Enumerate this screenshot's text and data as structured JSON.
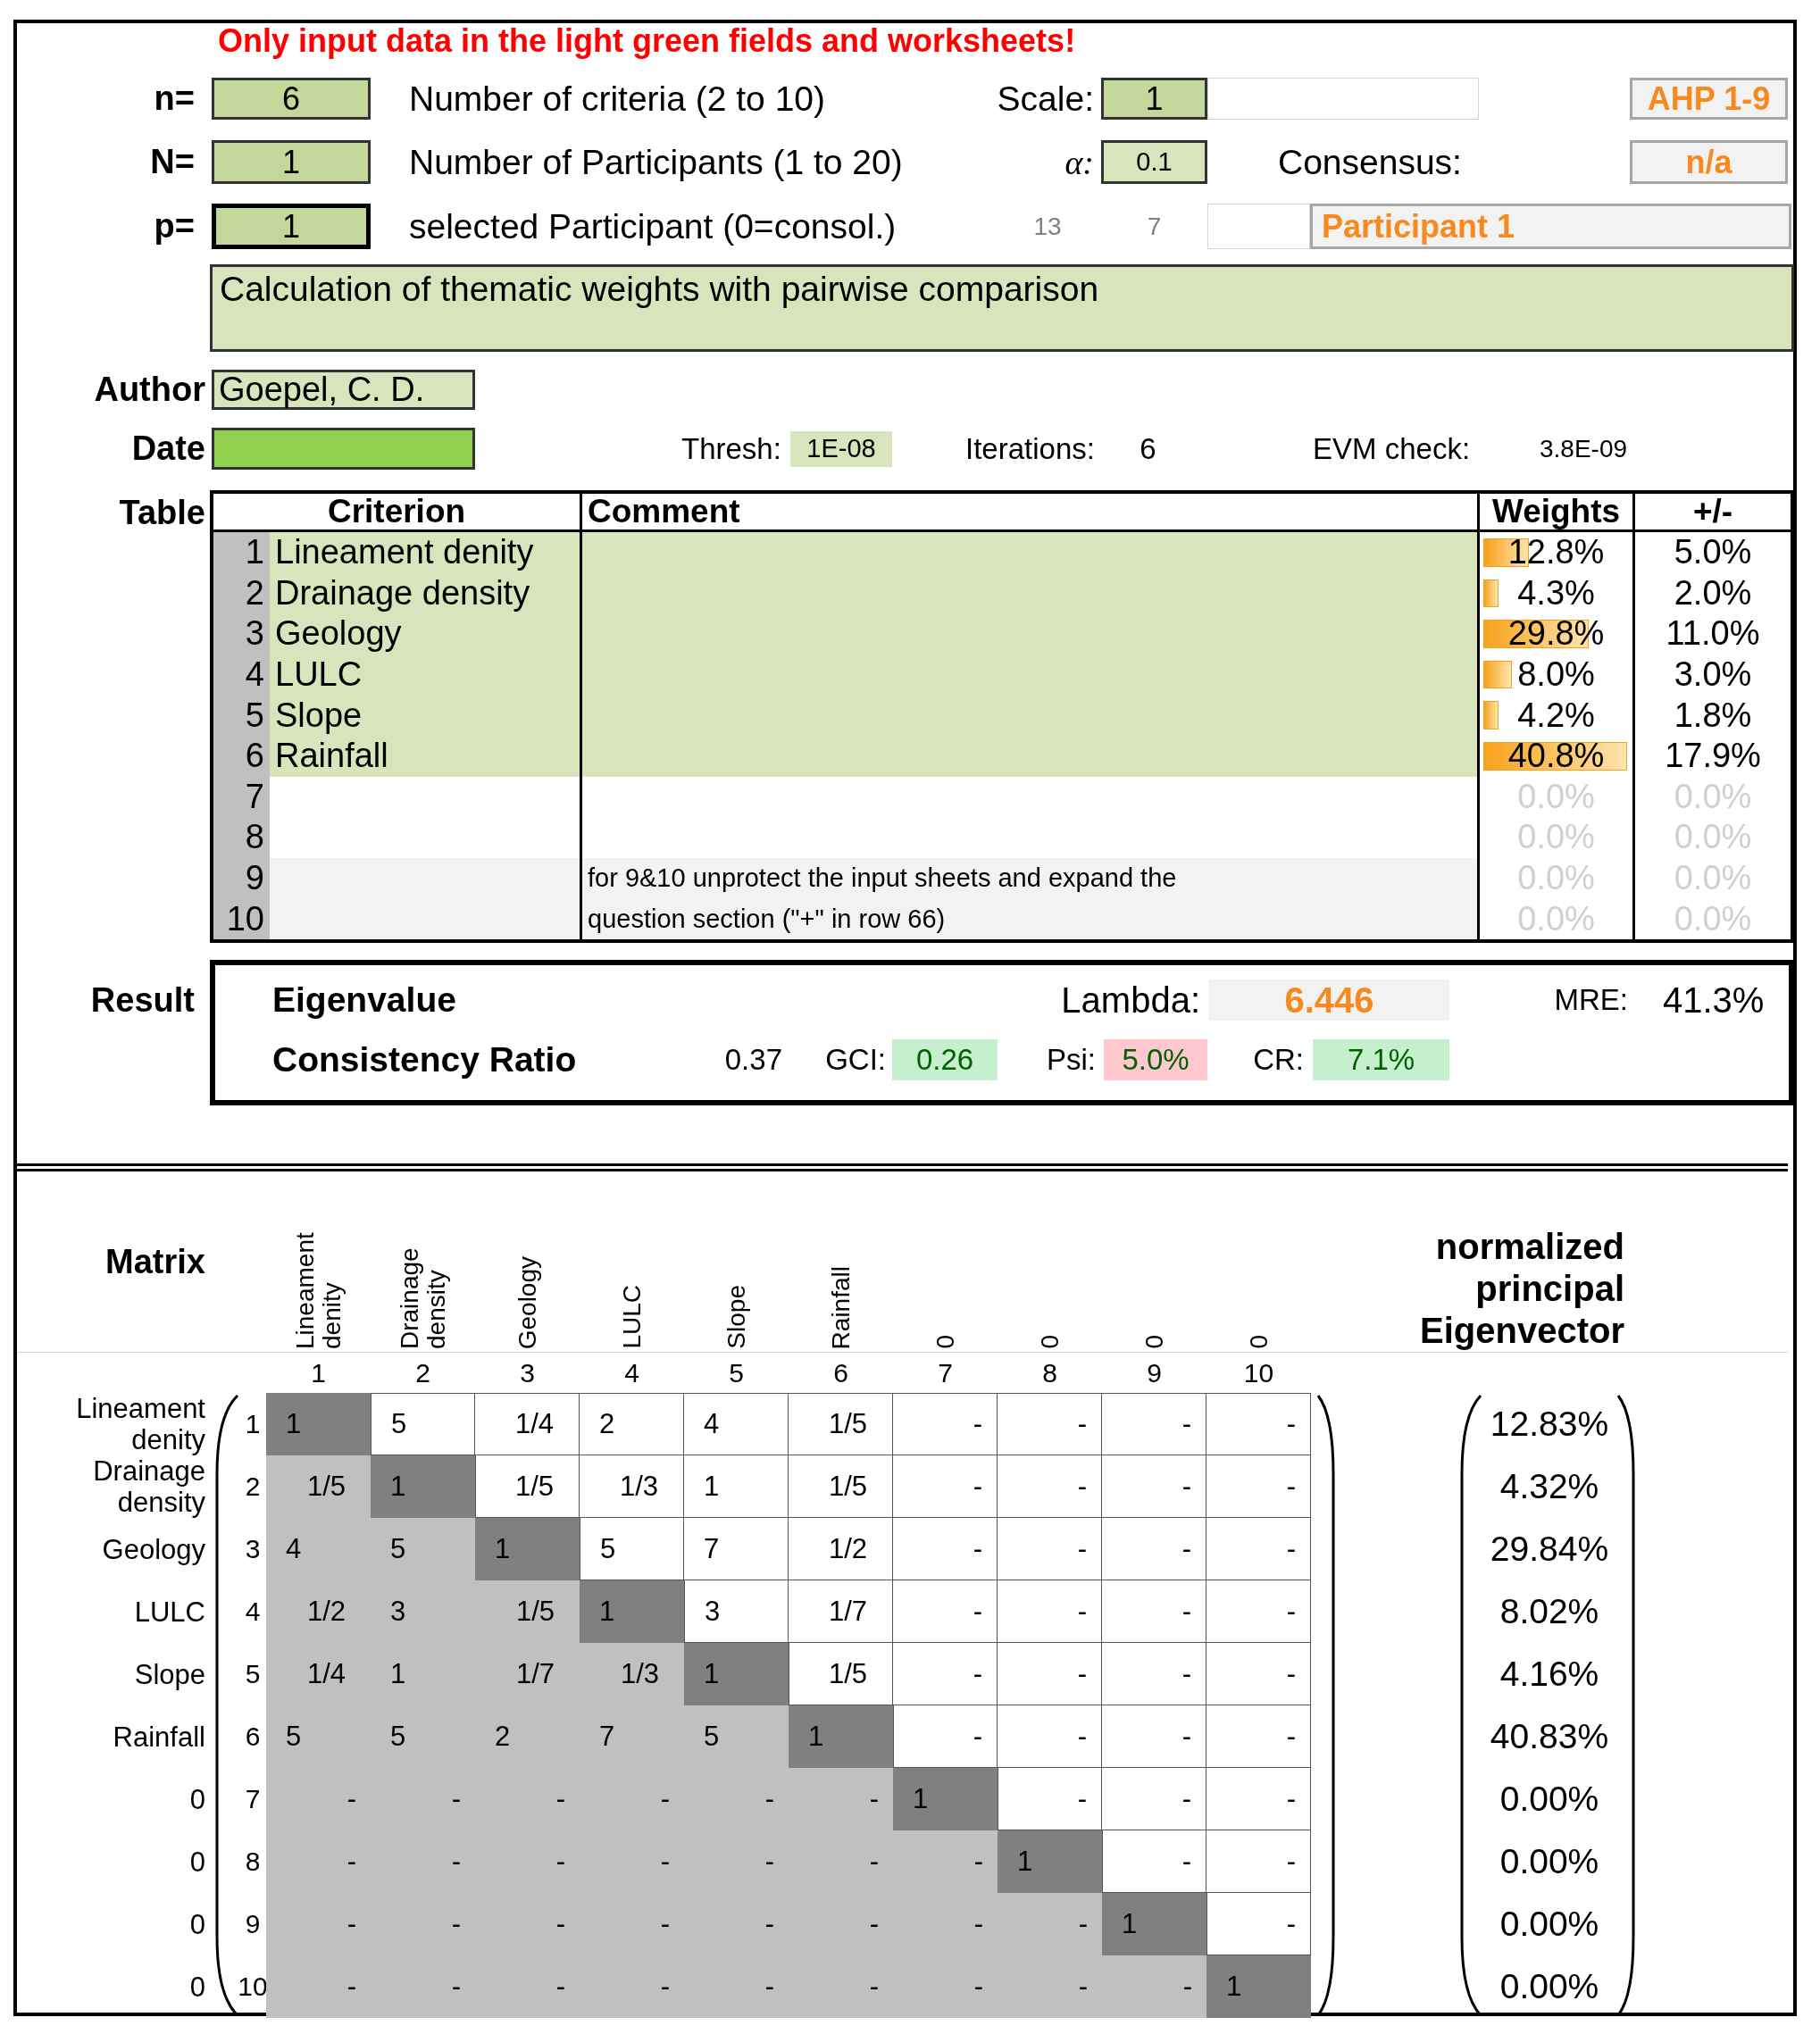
{
  "notice": "Only input data in the light green fields and worksheets!",
  "criteria_count": {
    "label": "n=",
    "value": "6",
    "description": "Number of criteria (2 to 10)",
    "focused": false
  },
  "scale": {
    "label": "Scale:",
    "value": "1",
    "name": "AHP 1-9"
  },
  "participants": {
    "label": "N=",
    "value": "1",
    "description": "Number of Participants (1 to 20)",
    "focused": false
  },
  "alpha": {
    "label": "α:",
    "value": "0.1"
  },
  "consensus": {
    "label": "Consensus:",
    "value": "n/a"
  },
  "participant": {
    "label": "p=",
    "value": "1",
    "description": "selected Participant (0=consol.)",
    "focused": true,
    "numbers": [
      "13",
      "7"
    ],
    "name": "Participant 1"
  },
  "project_title": "Calculation of thematic weights with pairwise comparison",
  "author": {
    "label": "Author",
    "value": "Goepel, C. D."
  },
  "date": {
    "label": "Date"
  },
  "solver": {
    "thresh_label": "Thresh:",
    "thresh": "1E-08",
    "iterations_label": "Iterations:",
    "iterations": "6",
    "evm_label": "EVM check:",
    "evm": "3.8E-09"
  },
  "table": {
    "label": "Table",
    "columns": [
      "Criterion",
      "Comment",
      "Weights",
      "+/-"
    ],
    "rows": [
      {
        "number": "1",
        "criterion": "Lineament denity",
        "weight": "12.8%",
        "level": 0.314,
        "error": "5.0%",
        "kind": "input",
        "disabled": false
      },
      {
        "number": "2",
        "criterion": "Drainage density",
        "weight": "4.3%",
        "level": 0.105,
        "error": "2.0%",
        "kind": "input",
        "disabled": false
      },
      {
        "number": "3",
        "criterion": "Geology",
        "weight": "29.8%",
        "level": 0.73,
        "error": "11.0%",
        "kind": "input",
        "disabled": false
      },
      {
        "number": "4",
        "criterion": "LULC",
        "weight": "8.0%",
        "level": 0.196,
        "error": "3.0%",
        "kind": "input",
        "disabled": false
      },
      {
        "number": "5",
        "criterion": "Slope",
        "weight": "4.2%",
        "level": 0.103,
        "error": "1.8%",
        "kind": "input",
        "disabled": false
      },
      {
        "number": "6",
        "criterion": "Rainfall",
        "weight": "40.8%",
        "level": 1,
        "error": "17.9%",
        "kind": "input",
        "disabled": false
      },
      {
        "number": "7",
        "weight": "0.0%",
        "error": "0.0%",
        "kind": "blank",
        "disabled": true
      },
      {
        "number": "8",
        "weight": "0.0%",
        "error": "0.0%",
        "kind": "blank",
        "disabled": true
      },
      {
        "number": "9",
        "comment": "for 9&10 unprotect the input sheets and expand the",
        "weight": "0.0%",
        "error": "0.0%",
        "kind": "note",
        "disabled": true
      },
      {
        "number": "10",
        "comment": "question section (\"+\" in row 66)",
        "weight": "0.0%",
        "error": "0.0%",
        "kind": "note",
        "disabled": true
      }
    ]
  },
  "result": {
    "label": "Result",
    "eigenvalue": {
      "name": "Eigenvalue",
      "label": "Lambda:",
      "value": "6.446",
      "mre_label": "MRE:",
      "mre": "41.3%"
    },
    "consistency": {
      "name": "Consistency Ratio",
      "value": "0.37",
      "metrics": [
        {
          "label": "GCI:",
          "value": "0.26",
          "kind": "pass"
        },
        {
          "label": "Psi:",
          "value": "5.0%",
          "kind": "fail"
        },
        {
          "label": "CR:",
          "value": "7.1%",
          "kind": "pass"
        }
      ]
    }
  },
  "matrix": {
    "label": "Matrix",
    "eigenvector_title": "normalized principal Eigenvector",
    "columns": [
      {
        "header": "Lineament denity",
        "number": "1"
      },
      {
        "header": "Drainage density",
        "number": "2"
      },
      {
        "header": "Geology",
        "number": "3"
      },
      {
        "header": "LULC",
        "number": "4"
      },
      {
        "header": "Slope",
        "number": "5"
      },
      {
        "header": "Rainfall",
        "number": "6"
      },
      {
        "header": "0",
        "number": "7"
      },
      {
        "header": "0",
        "number": "8"
      },
      {
        "header": "0",
        "number": "9"
      },
      {
        "header": "0",
        "number": "10"
      }
    ],
    "rows": [
      {
        "label": "Lineament denity",
        "number": "1",
        "cells": [
          "1",
          "5",
          "1/4",
          "2",
          "4",
          "1/5",
          "-",
          "-",
          "-",
          "-"
        ],
        "eigenvector": "12.83%"
      },
      {
        "label": "Drainage density",
        "number": "2",
        "cells": [
          "1/5",
          "1",
          "1/5",
          "1/3",
          "1",
          "1/5",
          "-",
          "-",
          "-",
          "-"
        ],
        "eigenvector": "4.32%"
      },
      {
        "label": "Geology",
        "number": "3",
        "cells": [
          "4",
          "5",
          "1",
          "5",
          "7",
          "1/2",
          "-",
          "-",
          "-",
          "-"
        ],
        "eigenvector": "29.84%"
      },
      {
        "label": "LULC",
        "number": "4",
        "cells": [
          "1/2",
          "3",
          "1/5",
          "1",
          "3",
          "1/7",
          "-",
          "-",
          "-",
          "-"
        ],
        "eigenvector": "8.02%"
      },
      {
        "label": "Slope",
        "number": "5",
        "cells": [
          "1/4",
          "1",
          "1/7",
          "1/3",
          "1",
          "1/5",
          "-",
          "-",
          "-",
          "-"
        ],
        "eigenvector": "4.16%"
      },
      {
        "label": "Rainfall",
        "number": "6",
        "cells": [
          "5",
          "5",
          "2",
          "7",
          "5",
          "1",
          "-",
          "-",
          "-",
          "-"
        ],
        "eigenvector": "40.83%"
      },
      {
        "label": "0",
        "number": "7",
        "cells": [
          "-",
          "-",
          "-",
          "-",
          "-",
          "-",
          "1",
          "-",
          "-",
          "-"
        ],
        "eigenvector": "0.00%"
      },
      {
        "label": "0",
        "number": "8",
        "cells": [
          "-",
          "-",
          "-",
          "-",
          "-",
          "-",
          "-",
          "1",
          "-",
          "-"
        ],
        "eigenvector": "0.00%"
      },
      {
        "label": "0",
        "number": "9",
        "cells": [
          "-",
          "-",
          "-",
          "-",
          "-",
          "-",
          "-",
          "-",
          "1",
          "-"
        ],
        "eigenvector": "0.00%"
      },
      {
        "label": "0",
        "number": "10",
        "cells": [
          "-",
          "-",
          "-",
          "-",
          "-",
          "-",
          "-",
          "-",
          "-",
          "1"
        ],
        "eigenvector": "0.00%"
      }
    ]
  }
}
